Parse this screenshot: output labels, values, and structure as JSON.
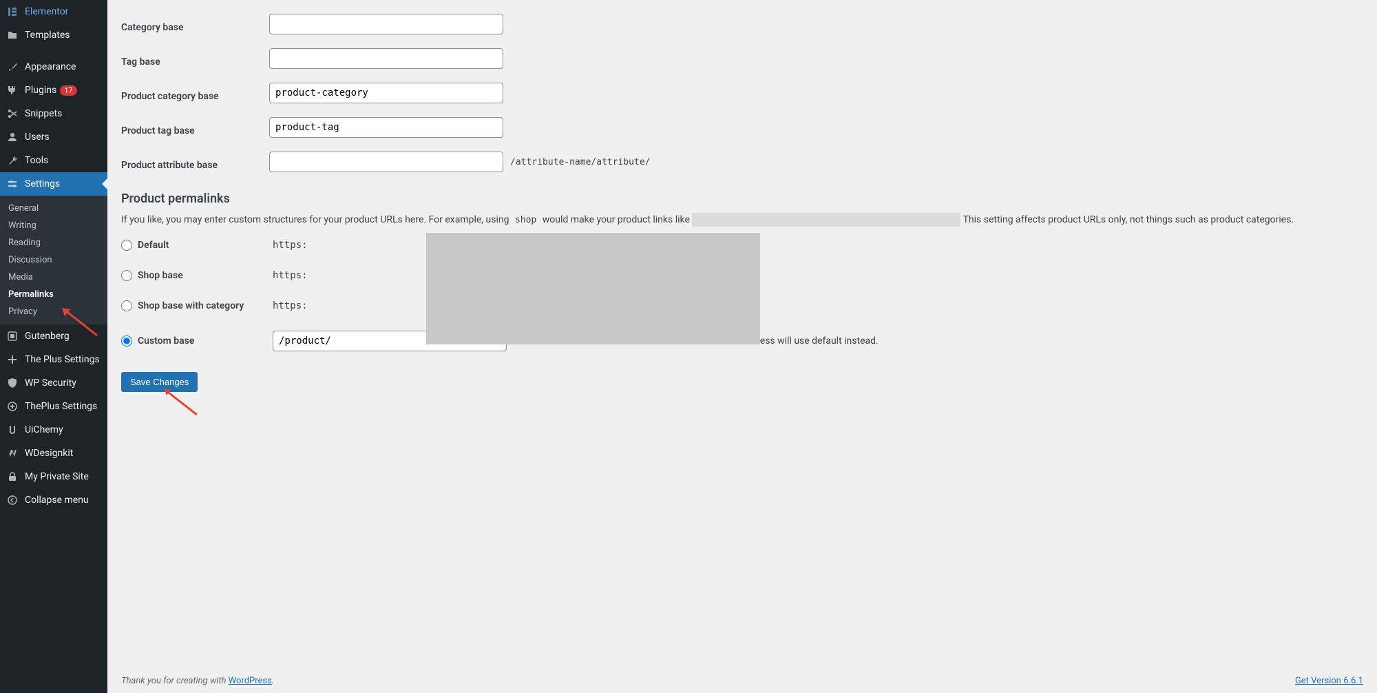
{
  "sidebar": {
    "menus": [
      {
        "label": "Elementor",
        "icon": "elementor"
      },
      {
        "label": "Templates",
        "icon": "folder"
      },
      {
        "label": "Appearance",
        "icon": "brush"
      },
      {
        "label": "Plugins",
        "icon": "plug",
        "badge": "17"
      },
      {
        "label": "Snippets",
        "icon": "scissors"
      },
      {
        "label": "Users",
        "icon": "user"
      },
      {
        "label": "Tools",
        "icon": "wrench"
      },
      {
        "label": "Settings",
        "icon": "sliders",
        "active": true
      },
      {
        "label": "Gutenberg",
        "icon": "block"
      },
      {
        "label": "The Plus Settings",
        "icon": "plus"
      },
      {
        "label": "WP Security",
        "icon": "shield"
      },
      {
        "label": "ThePlus Settings",
        "icon": "plus2"
      },
      {
        "label": "UiChemy",
        "icon": "uichemy"
      },
      {
        "label": "WDesignkit",
        "icon": "wdesign"
      },
      {
        "label": "My Private Site",
        "icon": "lock"
      },
      {
        "label": "Collapse menu",
        "icon": "collapse"
      }
    ],
    "submenu": {
      "items": [
        "General",
        "Writing",
        "Reading",
        "Discussion",
        "Media",
        "Permalinks",
        "Privacy"
      ],
      "current": "Permalinks"
    }
  },
  "form": {
    "category_base": {
      "label": "Category base",
      "value": ""
    },
    "tag_base": {
      "label": "Tag base",
      "value": ""
    },
    "product_category_base": {
      "label": "Product category base",
      "value": "product-category"
    },
    "product_tag_base": {
      "label": "Product tag base",
      "value": "product-tag"
    },
    "product_attribute_base": {
      "label": "Product attribute base",
      "value": "",
      "hint": "/attribute-name/attribute/"
    }
  },
  "permalinks": {
    "heading": "Product permalinks",
    "desc_prefix": "If you like, you may enter custom structures for your product URLs here. For example, using ",
    "desc_code": "shop",
    "desc_middle": " would make your product links like ",
    "desc_suffix": " This setting affects product URLs only, not things such as product categories.",
    "options": [
      {
        "label": "Default",
        "prefix": "https:"
      },
      {
        "label": "Shop base",
        "prefix": "https:"
      },
      {
        "label": "Shop base with category",
        "prefix": "https:"
      }
    ],
    "custom": {
      "label": "Custom base",
      "value": "/product/",
      "hint": "Enter a custom base to use. A base must be set or WordPress will use default instead."
    }
  },
  "save_button": "Save Changes",
  "footer": {
    "thanks_prefix": "Thank you for creating with ",
    "wp_link": "WordPress",
    "thanks_suffix": ".",
    "version_link": "Get Version 6.6.1"
  }
}
